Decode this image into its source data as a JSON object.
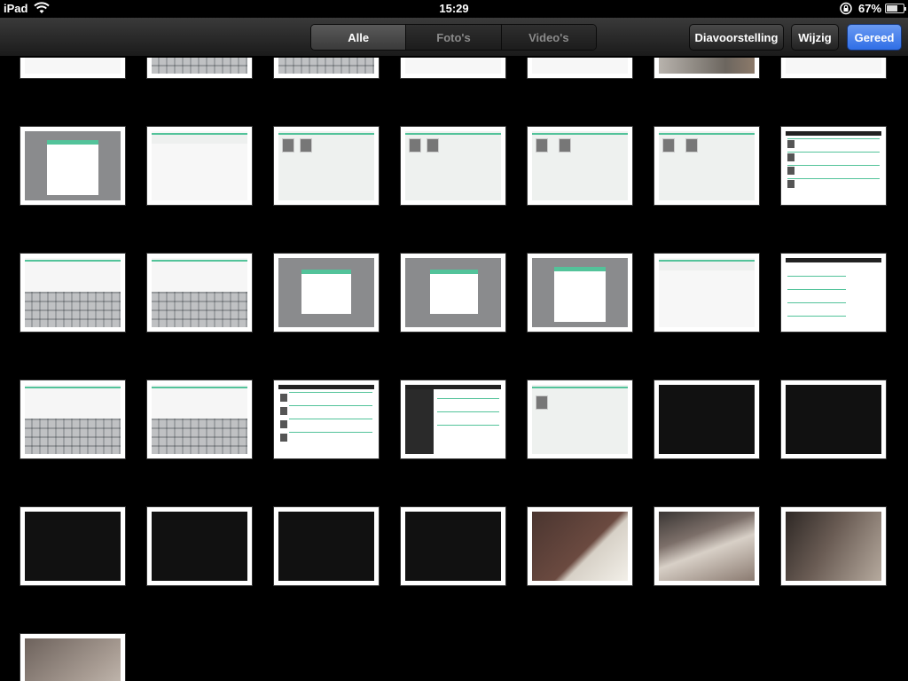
{
  "status_bar": {
    "device": "iPad",
    "time": "15:29",
    "battery_percent": "67%",
    "battery_level": 0.67,
    "icons": [
      "wifi-icon",
      "rotation-lock-icon",
      "battery-icon"
    ]
  },
  "toolbar": {
    "segments": [
      "Alle",
      "Foto's",
      "Video's"
    ],
    "selected_segment": "Alle",
    "slideshow_label": "Diavoorstelling",
    "edit_label": "Wijzig",
    "done_label": "Gereed",
    "done_color": "#2f6ee6"
  }
}
